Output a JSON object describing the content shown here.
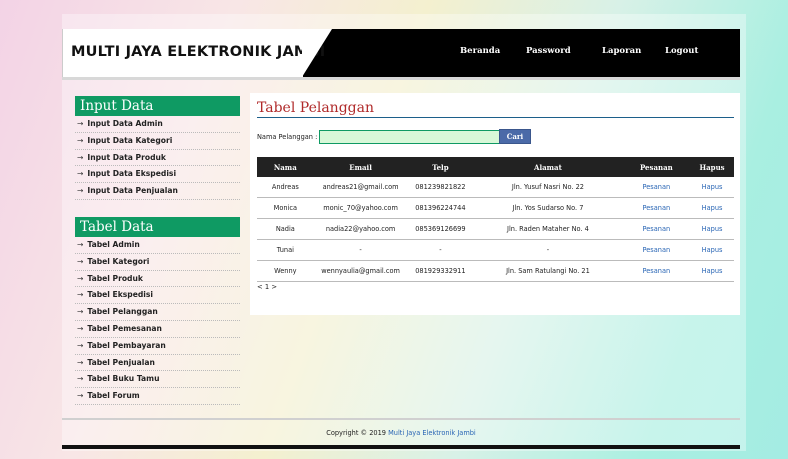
{
  "header": {
    "brand": "MULTI JAYA ELEKTRONIK JAMBI",
    "nav": [
      "Beranda",
      "Password",
      "Laporan",
      "Logout"
    ]
  },
  "sidebar": {
    "section1_title": "Input Data",
    "section1_items": [
      "Input Data Admin",
      "Input Data Kategori",
      "Input Data Produk",
      "Input Data Ekspedisi",
      "Input Data Penjualan"
    ],
    "section2_title": "Tabel Data",
    "section2_items": [
      "Tabel Admin",
      "Tabel Kategori",
      "Tabel Produk",
      "Tabel Ekspedisi",
      "Tabel Pelanggan",
      "Tabel Pemesanan",
      "Tabel Pembayaran",
      "Tabel Penjualan",
      "Tabel Buku Tamu",
      "Tabel Forum"
    ],
    "arrow": "→"
  },
  "main": {
    "title": "Tabel Pelanggan",
    "search_label": "Nama Pelanggan :",
    "search_value": "",
    "search_button": "Cari",
    "columns": [
      "Nama",
      "Email",
      "Telp",
      "Alamat",
      "Pesanan",
      "Hapus"
    ],
    "rows": [
      [
        "Andreas",
        "andreas21@gmail.com",
        "081239821822",
        "Jln. Yusuf Nasri No. 22",
        "Pesanan",
        "Hapus"
      ],
      [
        "Monica",
        "monic_70@yahoo.com",
        "081396224744",
        "Jln. Yos Sudarso No. 7",
        "Pesanan",
        "Hapus"
      ],
      [
        "Nadia",
        "nadia22@yahoo.com",
        "085369126699",
        "Jln. Raden Mataher No. 4",
        "Pesanan",
        "Hapus"
      ],
      [
        "Tunai",
        "-",
        "-",
        "-",
        "Pesanan",
        "Hapus"
      ],
      [
        "Wenny",
        "wennyaulia@gmail.com",
        "081929332911",
        "Jln. Sam Ratulangi No. 21",
        "Pesanan",
        "Hapus"
      ]
    ],
    "pagination": "< 1 >"
  },
  "footer": {
    "prefix": "Copyright © 2019 ",
    "link": "Multi Jaya Elektronik Jambi"
  }
}
